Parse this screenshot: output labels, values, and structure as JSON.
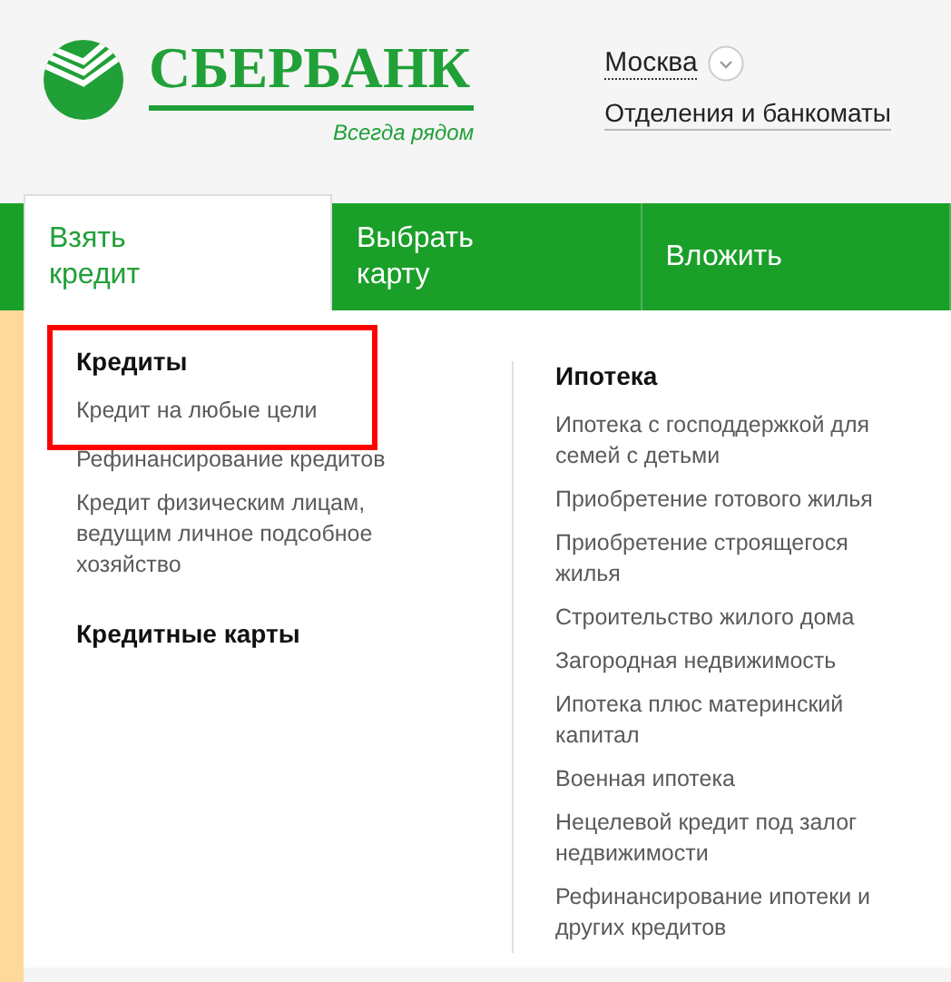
{
  "logo": {
    "name": "СБЕРБАНК",
    "tagline": "Всегда рядом"
  },
  "region": {
    "city": "Москва"
  },
  "branches_link": "Отделения и банкоматы",
  "tabs": [
    {
      "label": "Взять\nкредит",
      "selected": true
    },
    {
      "label": "Выбрать\nкарту",
      "selected": false
    },
    {
      "label": "Вложить",
      "selected": false
    }
  ],
  "menu_columns": [
    {
      "items": [
        {
          "kind": "heading",
          "text": "Кредиты",
          "highlighted": true
        },
        {
          "kind": "link",
          "text": "Кредит на любые цели",
          "highlighted": true
        },
        {
          "kind": "link",
          "text": "Рефинансирование кредитов",
          "highlighted": false
        },
        {
          "kind": "link",
          "text": "Кредит физическим лицам, ведущим личное подсобное хозяйство",
          "highlighted": false
        },
        {
          "kind": "heading",
          "text": "Кредитные карты",
          "highlighted": false
        }
      ]
    },
    {
      "items": [
        {
          "kind": "heading",
          "text": "Ипотека",
          "highlighted": false
        },
        {
          "kind": "link",
          "text": "Ипотека с господдержкой для семей с детьми",
          "highlighted": false
        },
        {
          "kind": "link",
          "text": "Приобретение готового жилья",
          "highlighted": false
        },
        {
          "kind": "link",
          "text": "Приобретение строящегося жилья",
          "highlighted": false
        },
        {
          "kind": "link",
          "text": "Строительство жилого дома",
          "highlighted": false
        },
        {
          "kind": "link",
          "text": "Загородная недвижимость",
          "highlighted": false
        },
        {
          "kind": "link",
          "text": "Ипотека плюс материнский капитал",
          "highlighted": false
        },
        {
          "kind": "link",
          "text": "Военная ипотека",
          "highlighted": false
        },
        {
          "kind": "link",
          "text": "Нецелевой кредит под залог недвижимости",
          "highlighted": false
        },
        {
          "kind": "link",
          "text": "Рефинансирование ипотеки и других кредитов",
          "highlighted": false
        }
      ]
    }
  ]
}
